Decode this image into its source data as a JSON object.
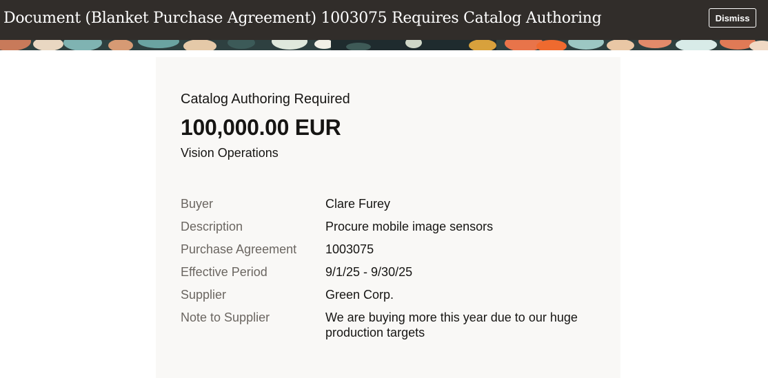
{
  "header": {
    "title": "Document (Blanket Purchase Agreement) 1003075 Requires Catalog Authoring",
    "dismiss_label": "Dismiss"
  },
  "card": {
    "subtitle": "Catalog Authoring Required",
    "amount": "100,000.00 EUR",
    "organization": "Vision Operations",
    "details": [
      {
        "label": "Buyer",
        "value": "Clare Furey"
      },
      {
        "label": "Description",
        "value": "Procure mobile image sensors"
      },
      {
        "label": "Purchase Agreement",
        "value": "1003075"
      },
      {
        "label": "Effective Period",
        "value": "9/1/25 - 9/30/25"
      },
      {
        "label": "Supplier",
        "value": "Green Corp."
      },
      {
        "label": "Note to Supplier",
        "value": "We are buying more this year due to our huge production targets"
      }
    ]
  },
  "colors": {
    "header_bg": "#312d2a",
    "card_bg": "#f9f8f6",
    "label_text": "#6b6661",
    "value_text": "#161513"
  }
}
